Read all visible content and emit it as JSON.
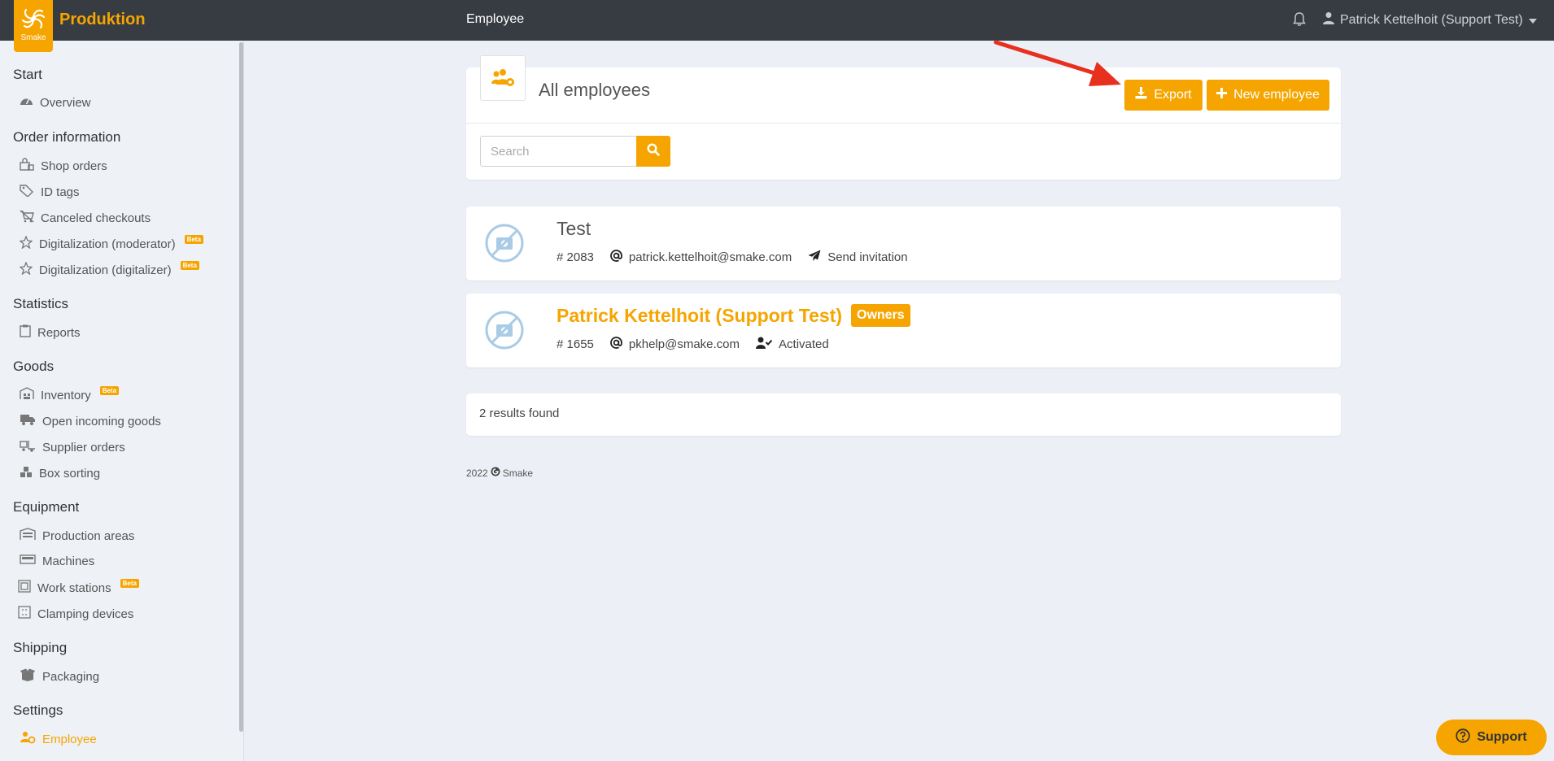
{
  "header": {
    "app_name": "Produktion",
    "logo_text": "Smake",
    "page_title": "Employee",
    "user_name": "Patrick Kettelhoit (Support Test)"
  },
  "sidebar": {
    "sections": [
      {
        "title": "Start",
        "items": [
          {
            "label": "Overview",
            "icon": "dashboard-icon"
          }
        ]
      },
      {
        "title": "Order information",
        "items": [
          {
            "label": "Shop orders",
            "icon": "shopping-bag-icon"
          },
          {
            "label": "ID tags",
            "icon": "tags-icon"
          },
          {
            "label": "Canceled checkouts",
            "icon": "cart-slash-icon"
          },
          {
            "label": "Digitalization (moderator)",
            "icon": "digitize-icon",
            "badge": "Beta"
          },
          {
            "label": "Digitalization (digitalizer)",
            "icon": "digitize-icon",
            "badge": "Beta"
          }
        ]
      },
      {
        "title": "Statistics",
        "items": [
          {
            "label": "Reports",
            "icon": "clipboard-icon"
          }
        ]
      },
      {
        "title": "Goods",
        "items": [
          {
            "label": "Inventory",
            "icon": "warehouse-icon",
            "badge": "Beta"
          },
          {
            "label": "Open incoming goods",
            "icon": "truck-icon"
          },
          {
            "label": "Supplier orders",
            "icon": "truck-loading-icon"
          },
          {
            "label": "Box sorting",
            "icon": "boxes-icon"
          }
        ]
      },
      {
        "title": "Equipment",
        "items": [
          {
            "label": "Production areas",
            "icon": "factory-icon"
          },
          {
            "label": "Machines",
            "icon": "machine-icon"
          },
          {
            "label": "Work stations",
            "icon": "workstation-icon",
            "badge": "Beta"
          },
          {
            "label": "Clamping devices",
            "icon": "clamp-icon"
          }
        ]
      },
      {
        "title": "Shipping",
        "items": [
          {
            "label": "Packaging",
            "icon": "box-open-icon"
          }
        ]
      },
      {
        "title": "Settings",
        "items": [
          {
            "label": "Employee",
            "icon": "users-cog-icon",
            "active": true
          }
        ]
      }
    ]
  },
  "main": {
    "title": "All employees",
    "export_label": "Export",
    "new_label": "New employee",
    "search_placeholder": "Search",
    "employees": [
      {
        "name": "Test",
        "id": "# 2083",
        "email": "patrick.kettelhoit@smake.com",
        "status": "Send invitation",
        "badge": ""
      },
      {
        "name": "Patrick Kettelhoit (Support Test)",
        "id": "# 1655",
        "email": "pkhelp@smake.com",
        "status": "Activated",
        "badge": "Owners"
      }
    ],
    "results_text": "2 results found"
  },
  "footer": {
    "year": "2022",
    "brand": "Smake"
  },
  "support_label": "Support",
  "colors": {
    "accent": "#f6a500",
    "topbar": "#373c43",
    "background": "#ecf0f6",
    "arrow": "#e8301e"
  }
}
